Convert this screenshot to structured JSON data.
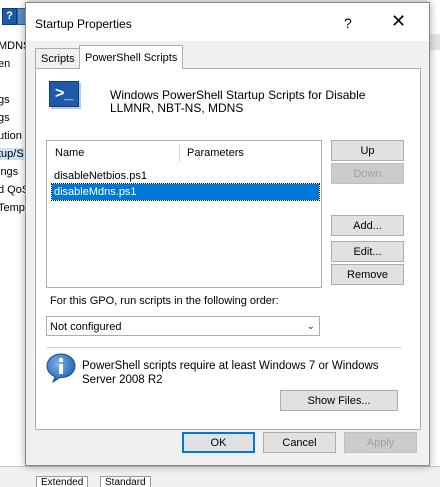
{
  "background": {
    "left_items": [
      "MDNS",
      "en",
      "gs",
      "gs",
      "ution",
      "tup/S",
      "ings",
      "d QoS",
      "Temp"
    ],
    "selected_item_index": 5,
    "bottom_tabs": [
      "Extended",
      "Standard"
    ]
  },
  "dialog": {
    "title": "Startup Properties",
    "help_label": "?",
    "close_label": "✕"
  },
  "tabs": [
    {
      "label": "Scripts",
      "active": false
    },
    {
      "label": "PowerShell Scripts",
      "active": true
    }
  ],
  "description": "Windows PowerShell Startup Scripts for Disable LLMNR, NBT-NS, MDNS",
  "script_list": {
    "columns": [
      "Name",
      "Parameters"
    ],
    "rows": [
      {
        "name": "disableNetbios.ps1",
        "parameters": "",
        "selected": false
      },
      {
        "name": "disableMdns.ps1",
        "parameters": "",
        "selected": true
      }
    ]
  },
  "side_buttons": {
    "up": "Up",
    "down": "Down",
    "add": "Add...",
    "edit": "Edit...",
    "remove": "Remove"
  },
  "order": {
    "label": "For this GPO, run scripts in the following order:",
    "selected": "Not configured"
  },
  "info_text": "PowerShell scripts require at least Windows 7 or Windows Server 2008 R2",
  "show_files": "Show Files...",
  "footer": {
    "ok": "OK",
    "cancel": "Cancel",
    "apply": "Apply"
  }
}
